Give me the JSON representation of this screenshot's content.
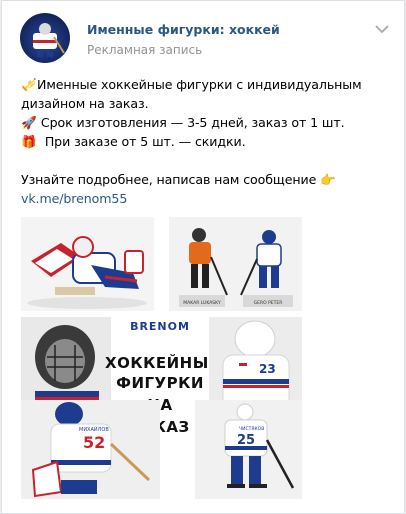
{
  "header": {
    "group_name": "Именные фигурки: хоккей",
    "post_type": "Рекламная запись",
    "menu_icon": "chevron-down-icon"
  },
  "post": {
    "line1": "Именные хоккейные фигурки с индивидуальным",
    "line2": "дизайном на заказ.",
    "line3": "Срок изготовления — 3-5 дней, заказ от 1 шт.",
    "line4": "При заказе от 5 шт. — скидки.",
    "line5": "Узнайте подробнее, написав нам сообщение",
    "link": "vk.me/brenom55",
    "emoji1": "🎺",
    "emoji2": "🚀",
    "emoji3": "🎁",
    "emoji4": "👉"
  },
  "promo": {
    "brand": "BRENOM",
    "line1": "ХОККЕЙНЫЕ",
    "line2": "ФИГУРКИ",
    "line3": "НА",
    "line4": "ЗАКАЗ"
  },
  "photos": {
    "nameplate_left": "MAKAR LUKASKY",
    "nameplate_right": "GERO PETER",
    "jersey_number": "52",
    "jersey_name": "МИХАЙЛОВ",
    "back_name": "ЧИСТЯКОВ",
    "back_number": "25",
    "helmet_number": "23"
  },
  "colors": {
    "link": "#2a5885",
    "meta": "#939393",
    "jersey_blue": "#1d3b8f",
    "jersey_red": "#c8232c"
  }
}
